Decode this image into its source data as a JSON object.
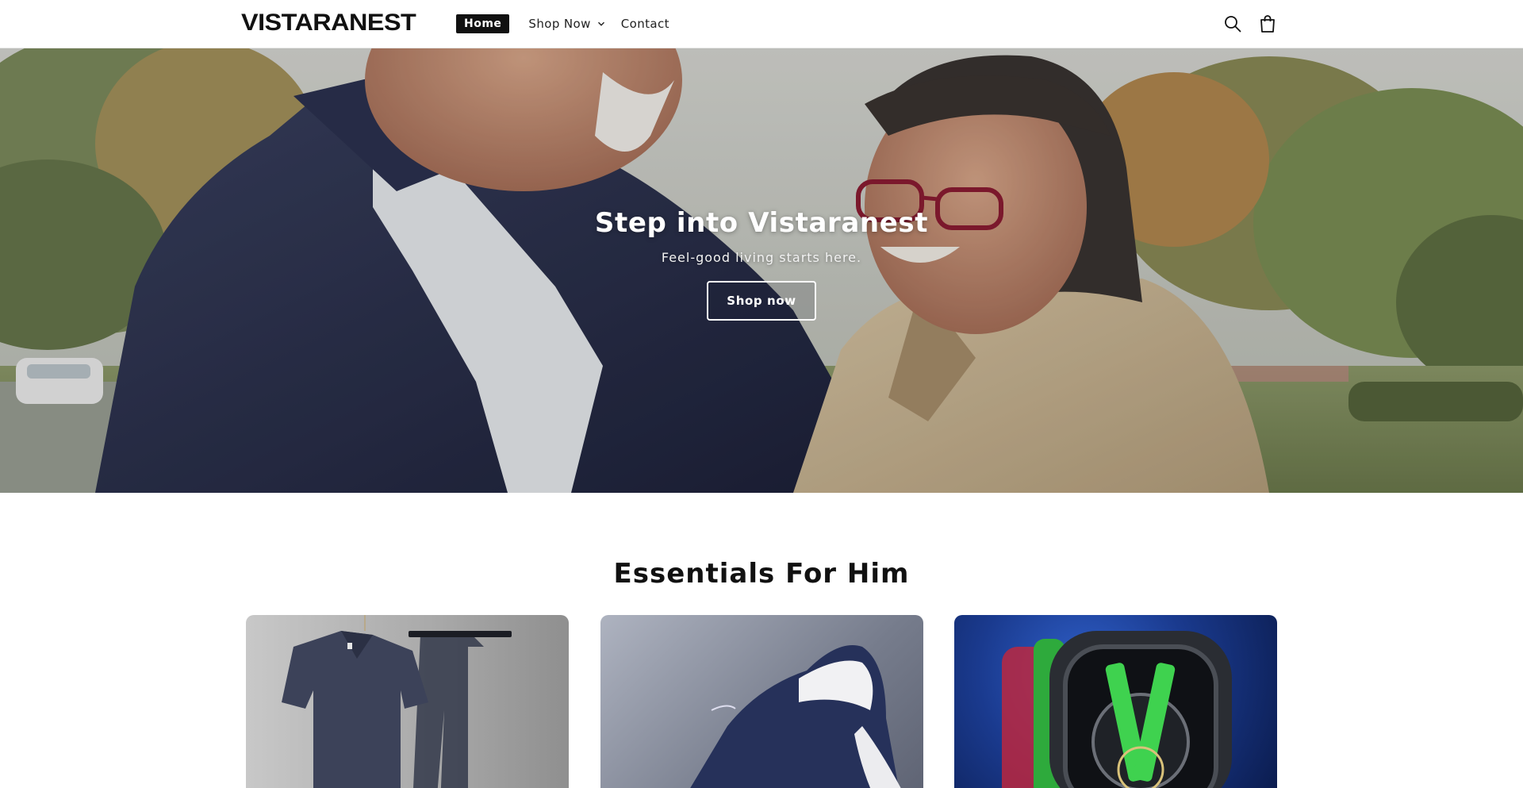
{
  "header": {
    "logo": "VISTARANEST",
    "nav": {
      "home": "Home",
      "shop_now": "Shop Now",
      "contact": "Contact"
    },
    "icons": [
      "search-icon",
      "cart-icon"
    ]
  },
  "hero": {
    "title": "Step into Vistaranest",
    "subtitle": "Feel-good living starts here.",
    "button": "Shop now"
  },
  "section": {
    "title": "Essentials For Him",
    "cards": [
      {
        "image": "polo-shirt-and-trousers-set"
      },
      {
        "image": "navy-leather-sneaker"
      },
      {
        "image": "green-skeleton-watch"
      }
    ]
  }
}
